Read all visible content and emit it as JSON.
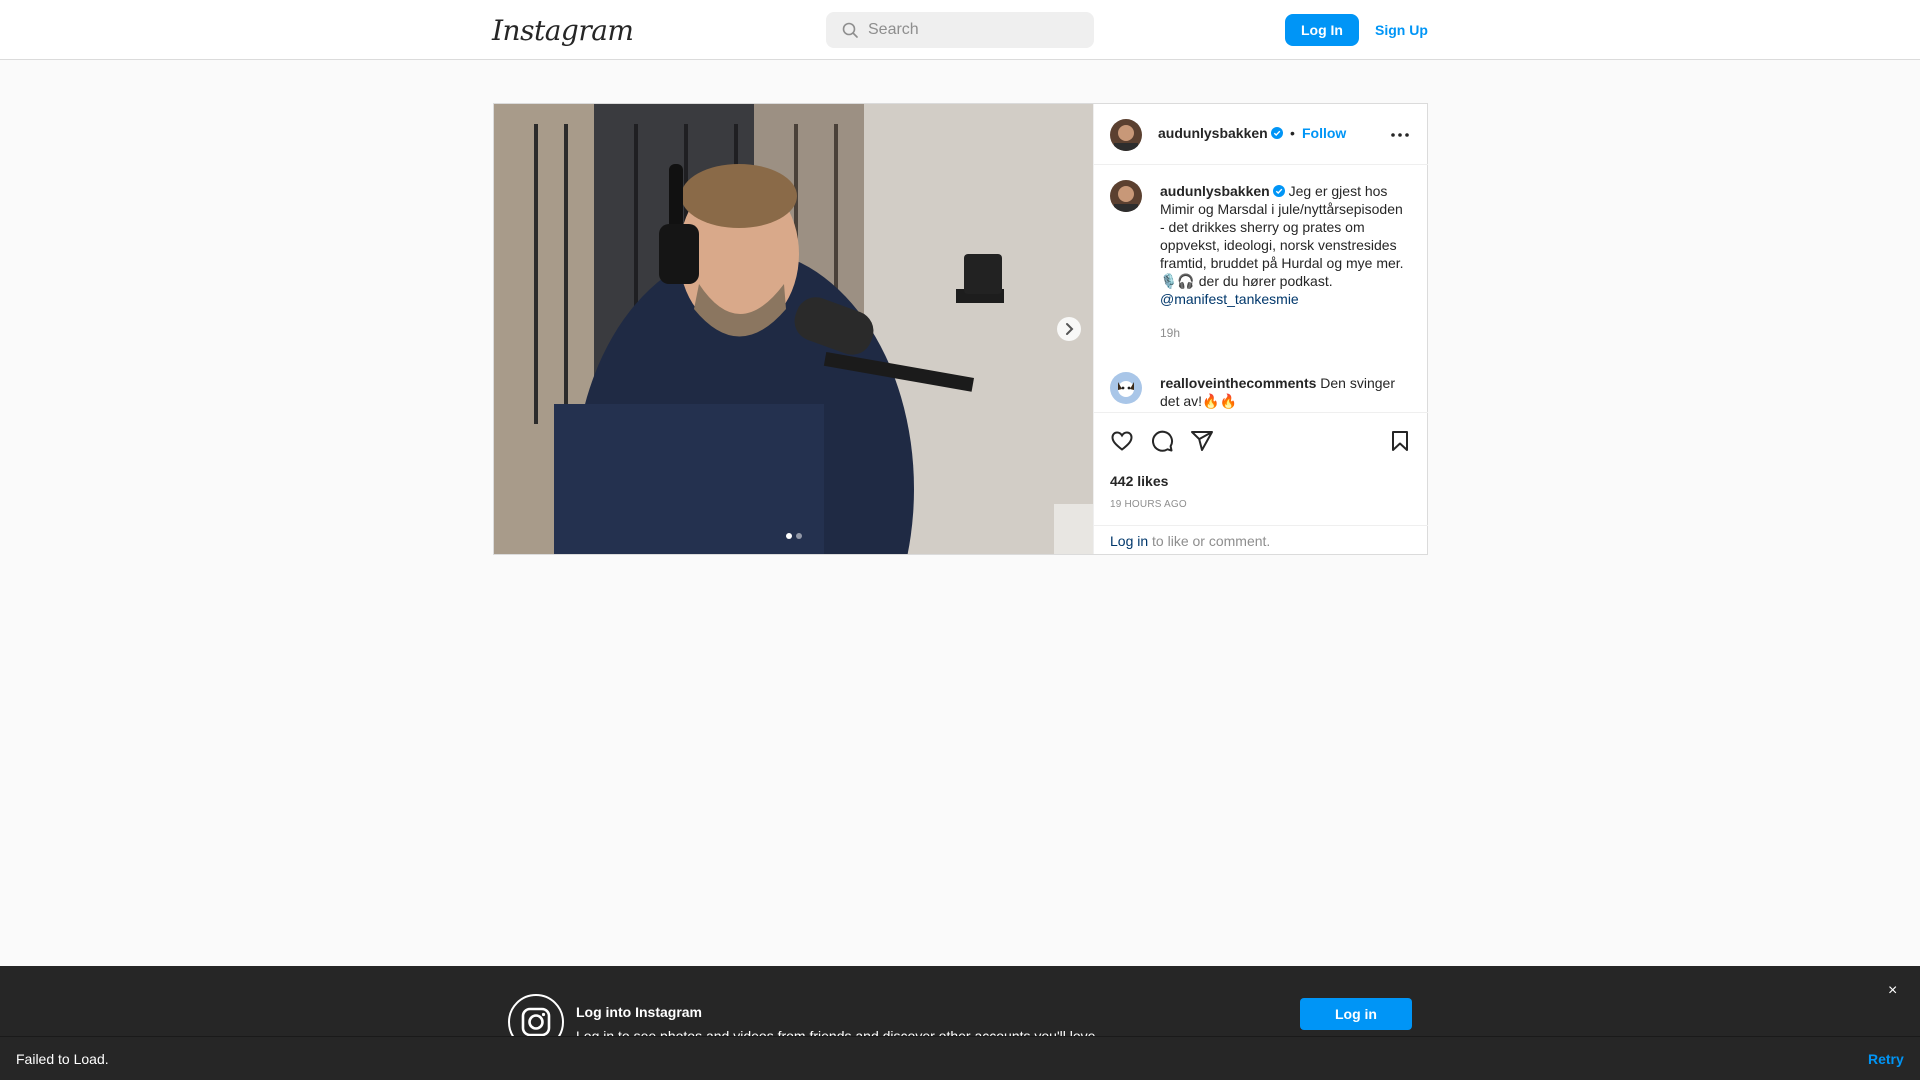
{
  "nav": {
    "logo_text": "Instagram",
    "search_placeholder": "Search",
    "login_label": "Log In",
    "signup_label": "Sign Up"
  },
  "post": {
    "header": {
      "username": "audunlysbakken",
      "separator": "•",
      "follow_label": "Follow"
    },
    "caption": {
      "username": "audunlysbakken",
      "text": "Jeg er gjest hos Mimir og Marsdal i jule/nyttårsepisoden - det drikkes sherry og prates om oppvekst, ideologi, norsk venstresides framtid, bruddet på Hurdal og mye mer. 🎙️🎧 der du hører podkast.",
      "mention": "@manifest_tankesmie",
      "time": "19h"
    },
    "comments": [
      {
        "username": "realloveinthecomments",
        "text": "Den svinger det av!🔥🔥"
      }
    ],
    "likes": "442 likes",
    "posted_ago": "19 HOURS AGO",
    "login_prompt": {
      "link": "Log in",
      "rest": " to like or comment."
    },
    "carousel": {
      "active_index": 0,
      "count": 2
    }
  },
  "banner": {
    "title": "Log into Instagram",
    "subtitle": "Log in to see photos and videos from friends and discover other accounts you'll love.",
    "login_label": "Log in",
    "close_glyph": "×"
  },
  "error_bar": {
    "message": "Failed to Load.",
    "retry_label": "Retry"
  },
  "colors": {
    "accent": "#0095f6",
    "link_dark": "#00376b",
    "muted": "#8e8e8e",
    "banner_bg": "#262626"
  }
}
